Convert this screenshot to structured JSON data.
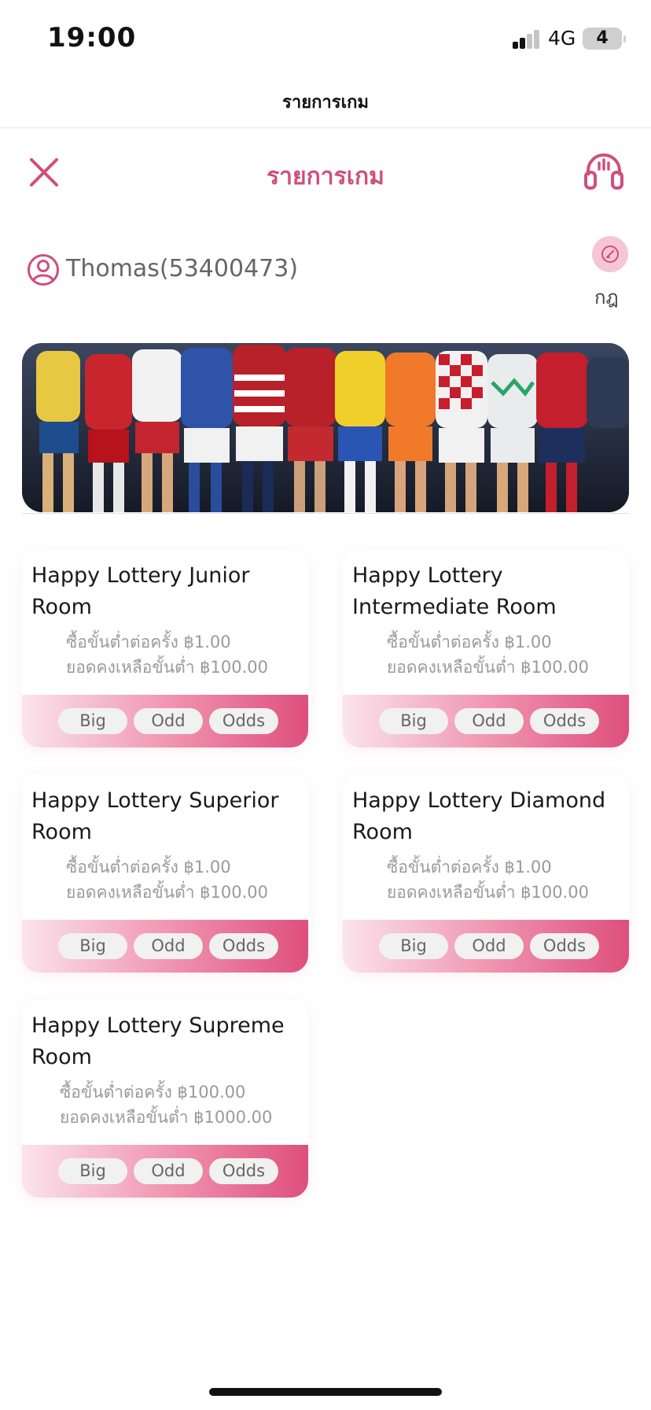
{
  "status_bar": {
    "time": "19:00",
    "network": "4G",
    "battery_level": "4",
    "signal_bars_active": 2,
    "signal_bars_total": 4
  },
  "nav": {
    "title": "รายการเกม"
  },
  "header": {
    "title": "รายการเกม",
    "close_icon": "close-icon",
    "support_icon": "headset-icon"
  },
  "user": {
    "name": "Thomas(53400473)",
    "avatar_icon": "user-circle-icon",
    "rules_label": "กฎ",
    "rules_icon": "pencil-icon"
  },
  "banner": {
    "image": "soccer-players-banner"
  },
  "rooms": [
    {
      "name": "Happy Lottery Junior Room",
      "min_bet": "ซื้อขั้นต่ำต่อครั้ง ฿1.00",
      "min_balance": "ยอดคงเหลือขั้นต่ำ ฿100.00",
      "tags": [
        "Big",
        "Odd",
        "Odds"
      ]
    },
    {
      "name": "Happy Lottery Intermediate Room",
      "min_bet": "ซื้อขั้นต่ำต่อครั้ง ฿1.00",
      "min_balance": "ยอดคงเหลือขั้นต่ำ ฿100.00",
      "tags": [
        "Big",
        "Odd",
        "Odds"
      ]
    },
    {
      "name": "Happy Lottery Superior Room",
      "min_bet": "ซื้อขั้นต่ำต่อครั้ง ฿1.00",
      "min_balance": "ยอดคงเหลือขั้นต่ำ ฿100.00",
      "tags": [
        "Big",
        "Odd",
        "Odds"
      ]
    },
    {
      "name": "Happy Lottery Diamond Room",
      "min_bet": "ซื้อขั้นต่ำต่อครั้ง ฿1.00",
      "min_balance": "ยอดคงเหลือขั้นต่ำ ฿100.00",
      "tags": [
        "Big",
        "Odd",
        "Odds"
      ]
    },
    {
      "name": "Happy Lottery Supreme Room",
      "min_bet": "ซื้อขั้นต่ำต่อครั้ง ฿100.00",
      "min_balance": "ยอดคงเหลือขั้นต่ำ ฿1000.00",
      "tags": [
        "Big",
        "Odd",
        "Odds"
      ]
    }
  ],
  "colors": {
    "accent": "#cf4f7c",
    "card_footer_start": "#fbe4ec",
    "card_footer_end": "#de4f7c",
    "tag_bg": "#f1f1f1"
  }
}
